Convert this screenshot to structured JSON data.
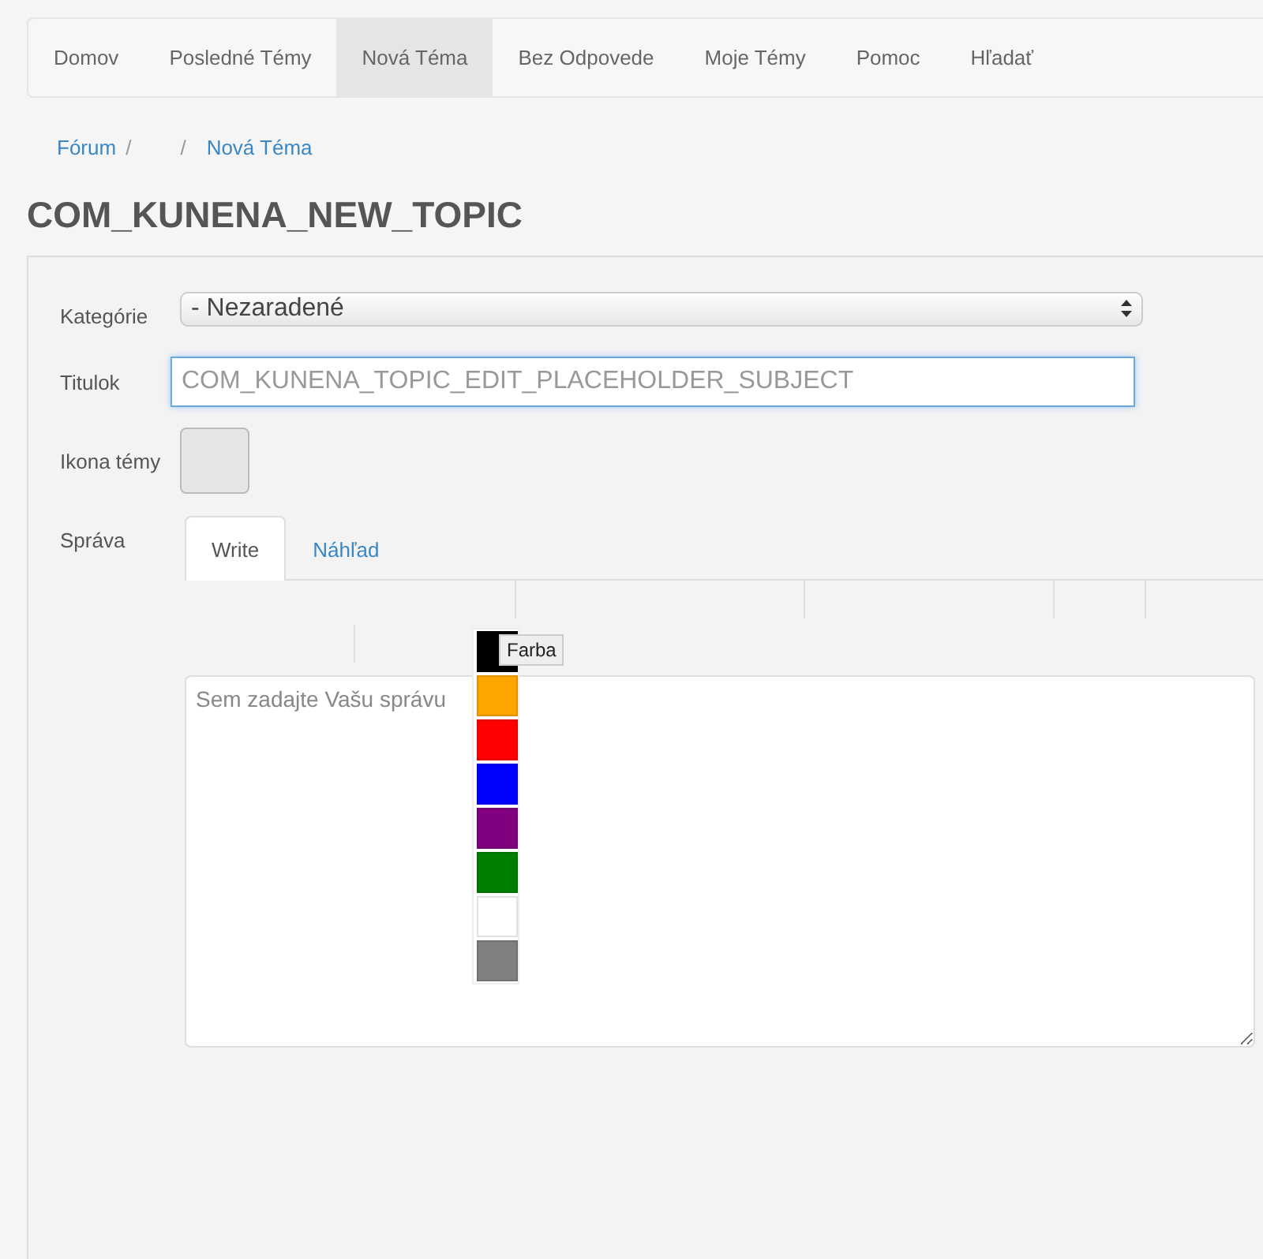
{
  "nav": [
    {
      "label": "Domov",
      "selected": false
    },
    {
      "label": "Posledné Témy",
      "selected": false
    },
    {
      "label": "Nová Téma",
      "selected": true
    },
    {
      "label": "Bez Odpovede",
      "selected": false
    },
    {
      "label": "Moje Témy",
      "selected": false
    },
    {
      "label": "Pomoc",
      "selected": false
    },
    {
      "label": "Hľadať",
      "selected": false
    }
  ],
  "breadcrumb": [
    {
      "kind": "link",
      "label": "Fórum"
    },
    {
      "kind": "separator",
      "label": "/"
    },
    {
      "kind": "blank"
    },
    {
      "kind": "separator",
      "label": "/"
    },
    {
      "kind": "link",
      "label": "Nová Téma"
    }
  ],
  "page_title": "COM_KUNENA_NEW_TOPIC",
  "form": {
    "category": {
      "label": "Kategórie",
      "value": "- Nezaradené"
    },
    "subject": {
      "label": "Titulok",
      "placeholder": "COM_KUNENA_TOPIC_EDIT_PLACEHOLDER_SUBJECT"
    },
    "topic_icon": {
      "label": "Ikona témy"
    },
    "message": {
      "label": "Správa",
      "tabs": [
        {
          "label": "Write",
          "selected": true
        },
        {
          "label": "Náhľad",
          "selected": false
        }
      ],
      "placeholder": "Sem zadajte Vašu správu",
      "color_menu": {
        "tooltip": "Farba",
        "swatches": [
          {
            "color": "#000000"
          },
          {
            "color": "#ffa500"
          },
          {
            "color": "#ff0000"
          },
          {
            "color": "#0000ff"
          },
          {
            "color": "#800080"
          },
          {
            "color": "#008000"
          },
          {
            "color": "#ffffff"
          },
          {
            "color": "#808080"
          }
        ]
      }
    }
  }
}
